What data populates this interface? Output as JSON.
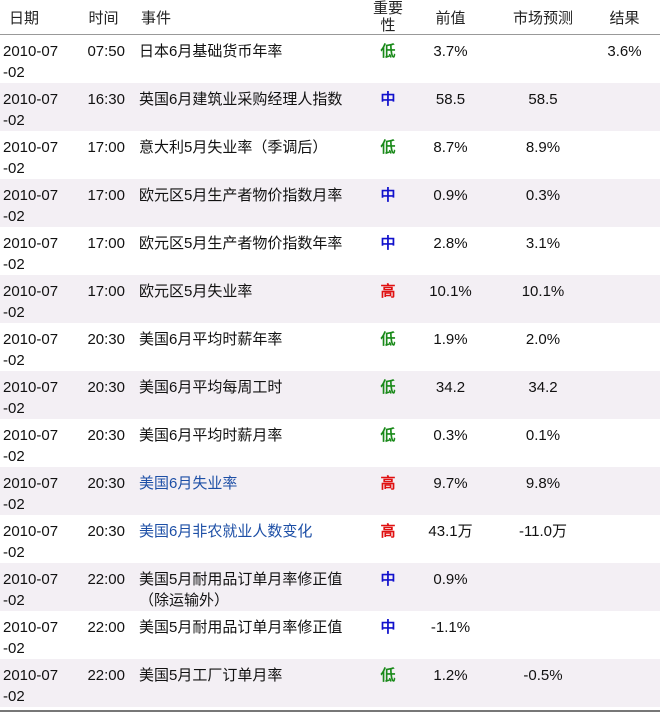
{
  "colors": {
    "high": "#e01010",
    "medium": "#1010cc",
    "low": "#1a8a1a",
    "link": "#1d4fa6",
    "stripe": "#f3eff4"
  },
  "headers": {
    "date": "日期",
    "time": "时间",
    "event": "事件",
    "importance": "重要性",
    "previous": "前值",
    "forecast": "市场预测",
    "result": "结果"
  },
  "rows": [
    {
      "date": "2010-07-02",
      "time": "07:50",
      "event": "日本6月基础货币年率",
      "importance": "低",
      "level": "low",
      "previous": "3.7%",
      "forecast": "",
      "result": "3.6%",
      "link": false
    },
    {
      "date": "2010-07-02",
      "time": "16:30",
      "event": "英国6月建筑业采购经理人指数",
      "importance": "中",
      "level": "medium",
      "previous": "58.5",
      "forecast": "58.5",
      "result": "",
      "link": false
    },
    {
      "date": "2010-07-02",
      "time": "17:00",
      "event": "意大利5月失业率（季调后）",
      "importance": "低",
      "level": "low",
      "previous": "8.7%",
      "forecast": "8.9%",
      "result": "",
      "link": false
    },
    {
      "date": "2010-07-02",
      "time": "17:00",
      "event": "欧元区5月生产者物价指数月率",
      "importance": "中",
      "level": "medium",
      "previous": "0.9%",
      "forecast": "0.3%",
      "result": "",
      "link": false
    },
    {
      "date": "2010-07-02",
      "time": "17:00",
      "event": "欧元区5月生产者物价指数年率",
      "importance": "中",
      "level": "medium",
      "previous": "2.8%",
      "forecast": "3.1%",
      "result": "",
      "link": false
    },
    {
      "date": "2010-07-02",
      "time": "17:00",
      "event": "欧元区5月失业率",
      "importance": "高",
      "level": "high",
      "previous": "10.1%",
      "forecast": "10.1%",
      "result": "",
      "link": false
    },
    {
      "date": "2010-07-02",
      "time": "20:30",
      "event": "美国6月平均时薪年率",
      "importance": "低",
      "level": "low",
      "previous": "1.9%",
      "forecast": "2.0%",
      "result": "",
      "link": false
    },
    {
      "date": "2010-07-02",
      "time": "20:30",
      "event": "美国6月平均每周工时",
      "importance": "低",
      "level": "low",
      "previous": "34.2",
      "forecast": "34.2",
      "result": "",
      "link": false
    },
    {
      "date": "2010-07-02",
      "time": "20:30",
      "event": "美国6月平均时薪月率",
      "importance": "低",
      "level": "low",
      "previous": "0.3%",
      "forecast": "0.1%",
      "result": "",
      "link": false
    },
    {
      "date": "2010-07-02",
      "time": "20:30",
      "event": "美国6月失业率",
      "importance": "高",
      "level": "high",
      "previous": "9.7%",
      "forecast": "9.8%",
      "result": "",
      "link": true
    },
    {
      "date": "2010-07-02",
      "time": "20:30",
      "event": "美国6月非农就业人数变化",
      "importance": "高",
      "level": "high",
      "previous": "43.1万",
      "forecast": "-11.0万",
      "result": "",
      "link": true
    },
    {
      "date": "2010-07-02",
      "time": "22:00",
      "event": "美国5月耐用品订单月率修正值（除运输外）",
      "importance": "中",
      "level": "medium",
      "previous": "0.9%",
      "forecast": "",
      "result": "",
      "link": false
    },
    {
      "date": "2010-07-02",
      "time": "22:00",
      "event": "美国5月耐用品订单月率修正值",
      "importance": "中",
      "level": "medium",
      "previous": "-1.1%",
      "forecast": "",
      "result": "",
      "link": false
    },
    {
      "date": "2010-07-02",
      "time": "22:00",
      "event": "美国5月工厂订单月率",
      "importance": "低",
      "level": "low",
      "previous": "1.2%",
      "forecast": "-0.5%",
      "result": "",
      "link": false
    }
  ]
}
